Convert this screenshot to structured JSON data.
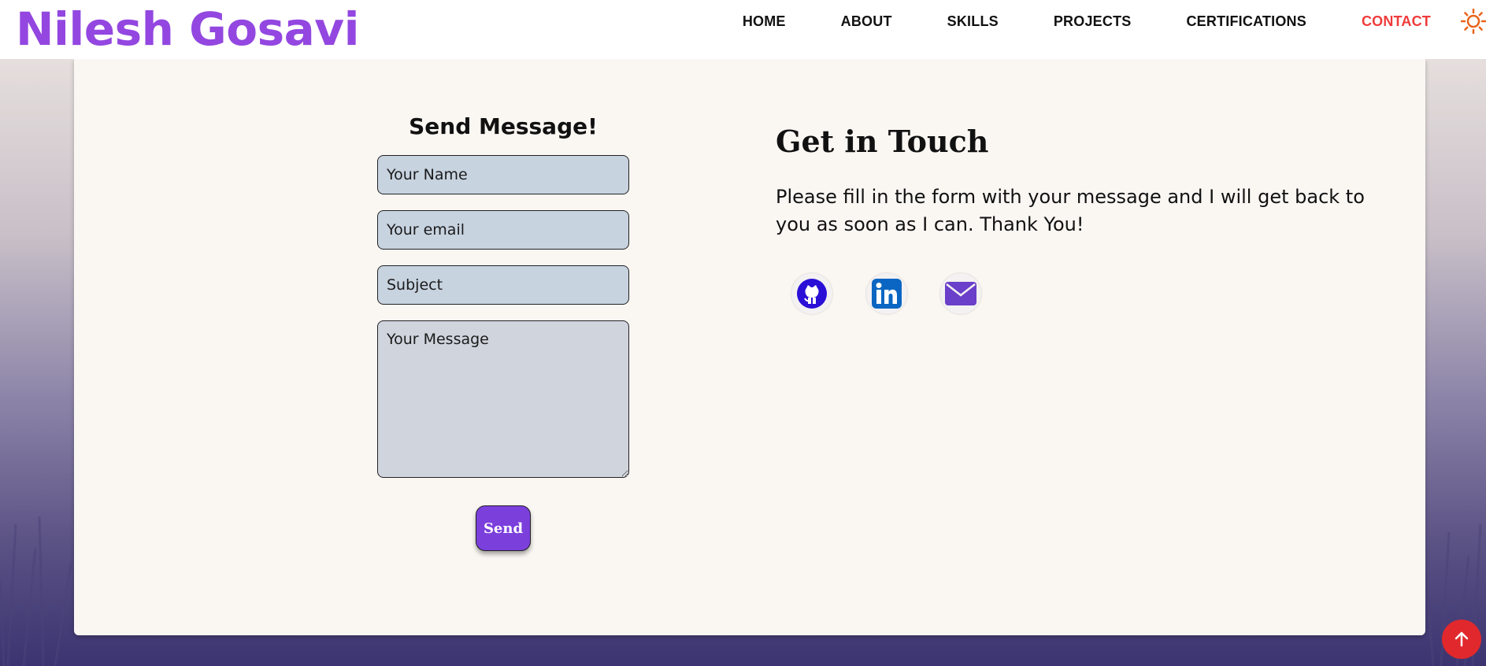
{
  "brand": {
    "name": "Nilesh Gosavi"
  },
  "nav": {
    "items": [
      {
        "label": "HOME"
      },
      {
        "label": "ABOUT"
      },
      {
        "label": "SKILLS"
      },
      {
        "label": "PROJECTS"
      },
      {
        "label": "CERTIFICATIONS"
      },
      {
        "label": "CONTACT",
        "active": true
      }
    ],
    "theme_icon": "sun-icon"
  },
  "form": {
    "title": "Send Message!",
    "name_placeholder": "Your Name",
    "email_placeholder": "Your email",
    "subject_placeholder": "Subject",
    "message_placeholder": "Your Message",
    "send_label": "Send"
  },
  "contact": {
    "title": "Get in Touch",
    "text": "Please fill in the form with your message and I will get back to you as soon as I can. Thank You!",
    "socials": [
      "github-icon",
      "linkedin-icon",
      "mail-icon"
    ]
  },
  "colors": {
    "brand": "#9347e0",
    "active_nav": "#ef3b3b",
    "send_button": "#7b3fdc",
    "scroll_top": "#e0282d"
  },
  "scroll_top_icon": "arrow-up-icon"
}
